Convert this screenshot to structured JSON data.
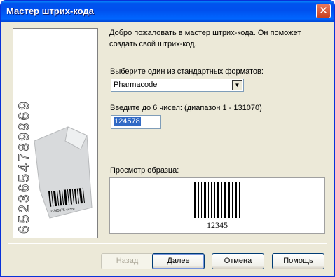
{
  "window": {
    "title": "Мастер штрих-кода",
    "close_label": "✕"
  },
  "side_panel": {
    "digits": "6523654789969",
    "sticker_number": "2 345675 4455-"
  },
  "intro": {
    "line1": "Добро пожаловать в мастер штрих-кода.  Он поможет",
    "line2": "создать свой штрих-код."
  },
  "format": {
    "label": "Выберите один из стандартных форматов:",
    "selected": "Pharmacode"
  },
  "number": {
    "label": "Введите до 6 чисел:  (диапазон 1 - 131070)",
    "value": "124578"
  },
  "preview": {
    "label": "Просмотр образца:",
    "caption": "12345"
  },
  "buttons": {
    "back": "Назад",
    "next": "Далее",
    "cancel": "Отмена",
    "help": "Помощь"
  },
  "colors": {
    "titlebar": "#0053ee",
    "dialog_bg": "#ece9d8",
    "selection": "#316ac5"
  }
}
